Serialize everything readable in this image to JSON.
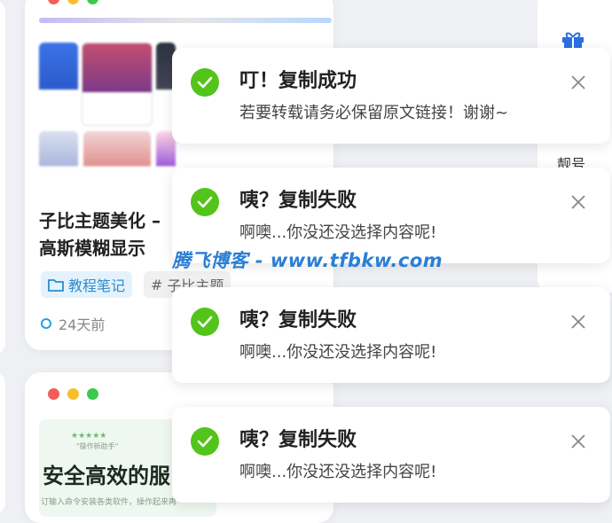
{
  "post": {
    "title_line1": "子比主题美化 –",
    "title_line2": "高斯模糊显示",
    "tag1": "教程笔记",
    "tag2": "子比主题",
    "time": "24天前"
  },
  "promo": {
    "stars": "★★★★★",
    "caption": "\"操作新助手\"",
    "headline": "安全高效的服",
    "footnote": "订输入命令安装各类软件，操作起来再"
  },
  "sidebar": {
    "label": "靓号"
  },
  "toasts": [
    {
      "title": "叮！复制成功",
      "message": "若要转载请务必保留原文链接！谢谢~"
    },
    {
      "title": "咦？复制失败",
      "message": "啊噢...你没还没选择内容呢!"
    },
    {
      "title": "咦？复制失败",
      "message": "啊噢...你没还没选择内容呢!"
    },
    {
      "title": "咦？复制失败",
      "message": "啊噢...你没还没选择内容呢!"
    }
  ],
  "watermark": "腾飞博客 - www.tfbkw.com",
  "colors": {
    "success": "#52c41a",
    "accent": "#29a0d9",
    "watermark": "#2a7fd4"
  }
}
